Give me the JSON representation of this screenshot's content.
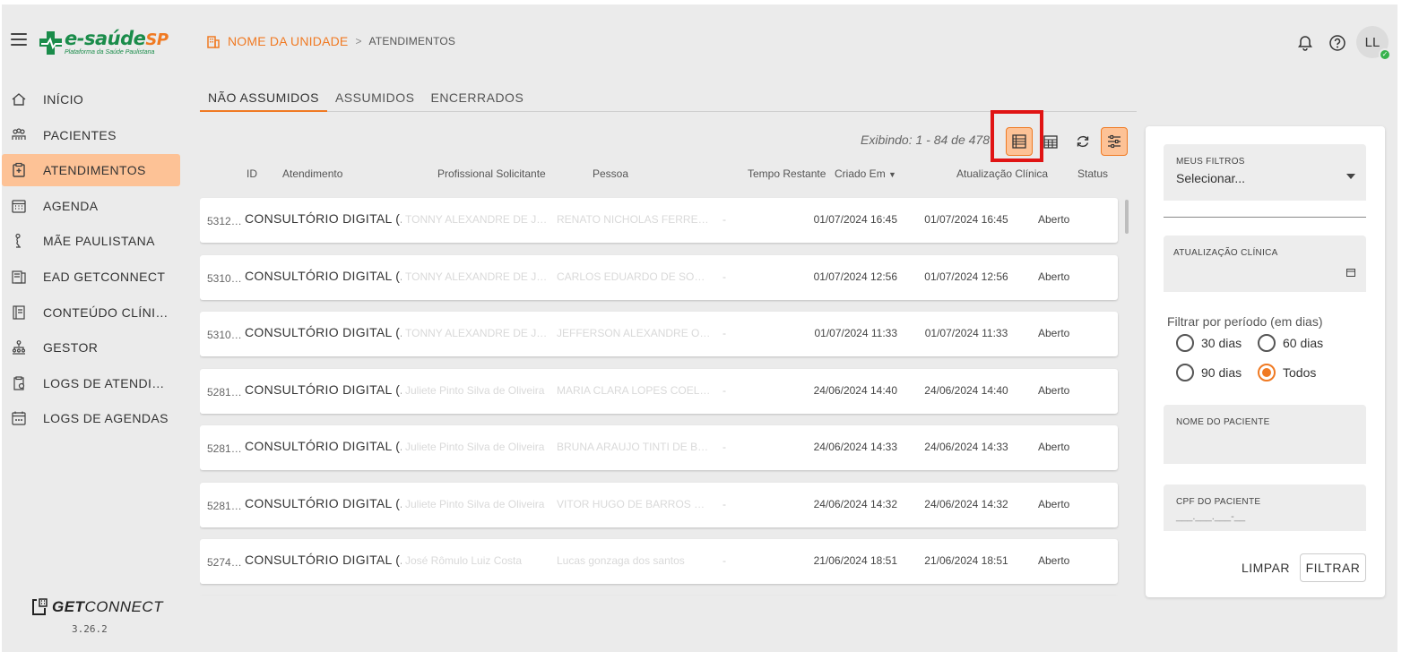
{
  "header": {
    "logo_text": "e-saúde",
    "logo_text_sp": "SP",
    "logo_subtitle": "Plataforma da Saúde Paulistana",
    "unit_name": "NOME DA UNIDADE",
    "separator": ">",
    "current_page": "ATENDIMENTOS",
    "avatar_initials": "LL",
    "avatar_badge": "✓",
    "icons": [
      "menu-icon",
      "building-icon",
      "bell-icon",
      "help-circle-icon"
    ]
  },
  "sidebar": {
    "items": [
      {
        "label": "INÍCIO",
        "icon": "home-icon"
      },
      {
        "label": "PACIENTES",
        "icon": "people-icon"
      },
      {
        "label": "ATENDIMENTOS",
        "icon": "clipboard-icon",
        "active": true
      },
      {
        "label": "AGENDA",
        "icon": "calendar-icon"
      },
      {
        "label": "MÃE PAULISTANA",
        "icon": "mother-icon"
      },
      {
        "label": "EAD GETCONNECT",
        "icon": "ead-icon"
      },
      {
        "label": "CONTEÚDO CLÍNICO",
        "icon": "book-icon"
      },
      {
        "label": "GESTOR",
        "icon": "hierarchy-icon"
      },
      {
        "label": "LOGS DE ATENDIMENTOS",
        "icon": "clipboard-log-icon"
      },
      {
        "label": "LOGS DE AGENDAS",
        "icon": "calendar-log-icon"
      }
    ],
    "brand_bold": "GET",
    "brand_light": "CONNECT",
    "version": "3.26.2"
  },
  "tabs": [
    {
      "label": "NÃO ASSUMIDOS",
      "active": true
    },
    {
      "label": "ASSUMIDOS"
    },
    {
      "label": "ENCERRADOS"
    }
  ],
  "toolbar": {
    "count_text": "Exibindo: 1 - 84 de 478",
    "buttons": [
      "list-view-icon",
      "grid-view-icon",
      "refresh-icon",
      "filter-settings-icon"
    ]
  },
  "table": {
    "columns": {
      "id": "ID",
      "atendimento": "Atendimento",
      "profissional": "Profissional Solicitante",
      "pessoa": "Pessoa",
      "tempo": "Tempo Restante",
      "criado": "Criado Em",
      "atualizacao": "Atualização Clínica",
      "status": "Status"
    },
    "rows": [
      {
        "id": "5312…",
        "atendimento": "CONSULTÓRIO DIGITAL (...",
        "profissional": "TONNY ALEXANDRE DE JESU...",
        "pessoa": "RENATO NICHOLAS FERREIR...",
        "tempo": "-",
        "criado": "01/07/2024 16:45",
        "atualizacao": "01/07/2024 16:45",
        "status": "Aberto"
      },
      {
        "id": "5310…",
        "atendimento": "CONSULTÓRIO DIGITAL (...",
        "profissional": "TONNY ALEXANDRE DE JESU...",
        "pessoa": "CARLOS EDUARDO DE SOUZA...",
        "tempo": "-",
        "criado": "01/07/2024 12:56",
        "atualizacao": "01/07/2024 12:56",
        "status": "Aberto"
      },
      {
        "id": "5310…",
        "atendimento": "CONSULTÓRIO DIGITAL (...",
        "profissional": "TONNY ALEXANDRE DE JESU...",
        "pessoa": "JEFFERSON ALEXANDRE OLI...",
        "tempo": "-",
        "criado": "01/07/2024 11:33",
        "atualizacao": "01/07/2024 11:33",
        "status": "Aberto"
      },
      {
        "id": "5281…",
        "atendimento": "CONSULTÓRIO DIGITAL (...",
        "profissional": "Juliete Pinto Silva de Oliveira",
        "pessoa": "MARIA CLARA LOPES COELHO",
        "tempo": "-",
        "criado": "24/06/2024 14:40",
        "atualizacao": "24/06/2024 14:40",
        "status": "Aberto"
      },
      {
        "id": "5281…",
        "atendimento": "CONSULTÓRIO DIGITAL (...",
        "profissional": "Juliete Pinto Silva de Oliveira",
        "pessoa": "BRUNA ARAUJO TINTI DE BA...",
        "tempo": "-",
        "criado": "24/06/2024 14:33",
        "atualizacao": "24/06/2024 14:33",
        "status": "Aberto"
      },
      {
        "id": "5281…",
        "atendimento": "CONSULTÓRIO DIGITAL (...",
        "profissional": "Juliete Pinto Silva de Oliveira",
        "pessoa": "VITOR HUGO DE BARROS PIN...",
        "tempo": "-",
        "criado": "24/06/2024 14:32",
        "atualizacao": "24/06/2024 14:32",
        "status": "Aberto"
      },
      {
        "id": "5274…",
        "atendimento": "CONSULTÓRIO DIGITAL (...",
        "profissional": "José Rômulo Luiz Costa",
        "pessoa": "Lucas gonzaga dos santos",
        "tempo": "-",
        "criado": "21/06/2024 18:51",
        "atualizacao": "21/06/2024 18:51",
        "status": "Aberto"
      }
    ]
  },
  "filters": {
    "meus_filtros_label": "MEUS FILTROS",
    "meus_filtros_value": "Selecionar...",
    "atualizacao_label": "ATUALIZAÇÃO CLÍNICA",
    "period_label": "Filtrar por período (em dias)",
    "periods": [
      {
        "label": "30 dias"
      },
      {
        "label": "60 dias"
      },
      {
        "label": "90 dias"
      },
      {
        "label": "Todos",
        "selected": true
      }
    ],
    "nome_label": "NOME DO PACIENTE",
    "cpf_label": "CPF DO PACIENTE",
    "cpf_placeholder": "___.___.___-__",
    "clear_label": "LIMPAR",
    "filter_label": "FILTRAR"
  },
  "colors": {
    "accent": "#f07a23",
    "active_bg": "#fdc296",
    "highlight": "#e01414",
    "brand_green": "#1a8c4a"
  }
}
